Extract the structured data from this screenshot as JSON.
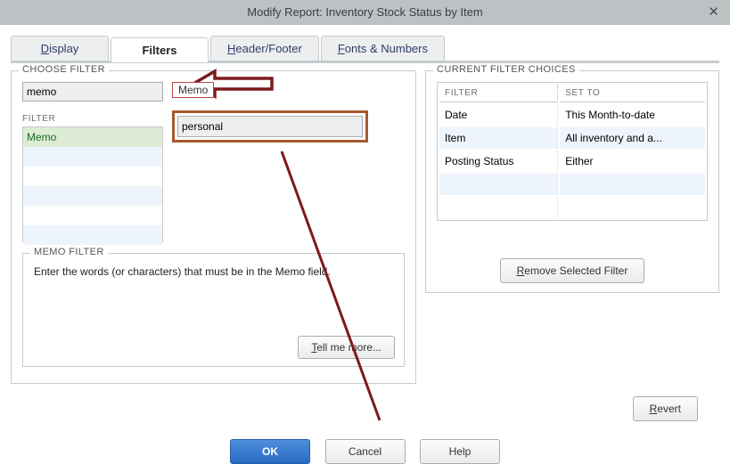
{
  "window": {
    "title": "Modify Report: Inventory Stock Status by Item",
    "close_glyph": "✕"
  },
  "tabs": {
    "display": "isplay",
    "display_prefix": "D",
    "filters": "Filters",
    "header_prefix": "H",
    "header": "eader/Footer",
    "fonts_prefix": "F",
    "fonts": "onts & Numbers"
  },
  "choose_filter": {
    "legend": "CHOOSE FILTER",
    "search_value": "memo",
    "column_label": "FILTER",
    "items": [
      "Memo"
    ],
    "chip_label": "Memo",
    "value_input": "personal"
  },
  "memo_filter": {
    "legend": "MEMO FILTER",
    "hint": "Enter the words (or characters) that must be in the Memo field.",
    "tell_me_more_prefix": "T",
    "tell_me_more": "ell me more..."
  },
  "current_choices": {
    "legend": "CURRENT FILTER CHOICES",
    "col_filter": "FILTER",
    "col_set_to": "SET TO",
    "rows": [
      {
        "filter": "Date",
        "set_to": "This Month-to-date",
        "sel": false
      },
      {
        "filter": "Item",
        "set_to": "All inventory and a...",
        "sel": true
      },
      {
        "filter": "Posting Status",
        "set_to": "Either",
        "sel": false
      }
    ],
    "remove_btn_prefix": "R",
    "remove_btn": "emove Selected Filter"
  },
  "buttons": {
    "revert_prefix": "R",
    "revert": "evert",
    "ok": "OK",
    "cancel": "Cancel",
    "help": "Help"
  },
  "colors": {
    "annotation": "#7d1a1a"
  }
}
